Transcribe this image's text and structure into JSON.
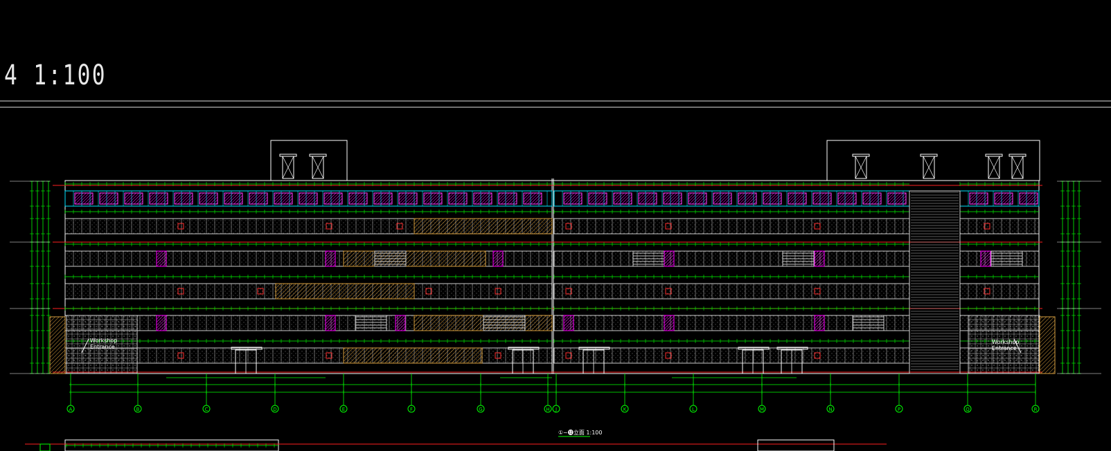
{
  "drawing": {
    "title": "4  1:100",
    "caption": "①~⓬立面  1:100",
    "entrance_left": [
      "Workshop",
      "Entrance"
    ],
    "entrance_right": [
      "Workshop",
      "Entrance"
    ],
    "grid_axes": [
      "A",
      "B",
      "C",
      "D",
      "E",
      "F",
      "G",
      "H",
      "J",
      "K",
      "L",
      "M",
      "N",
      "P",
      "Q",
      "R"
    ]
  },
  "colors": {
    "background": "#000000",
    "outline": "#ffffff",
    "dimension": "#00ff00",
    "axis_red": "#ff2020",
    "window_cyan": "#00e5ff",
    "hatch_magenta": "#ff00ff",
    "hatch_orange": "#d9a040",
    "door_red": "#ff3030"
  }
}
